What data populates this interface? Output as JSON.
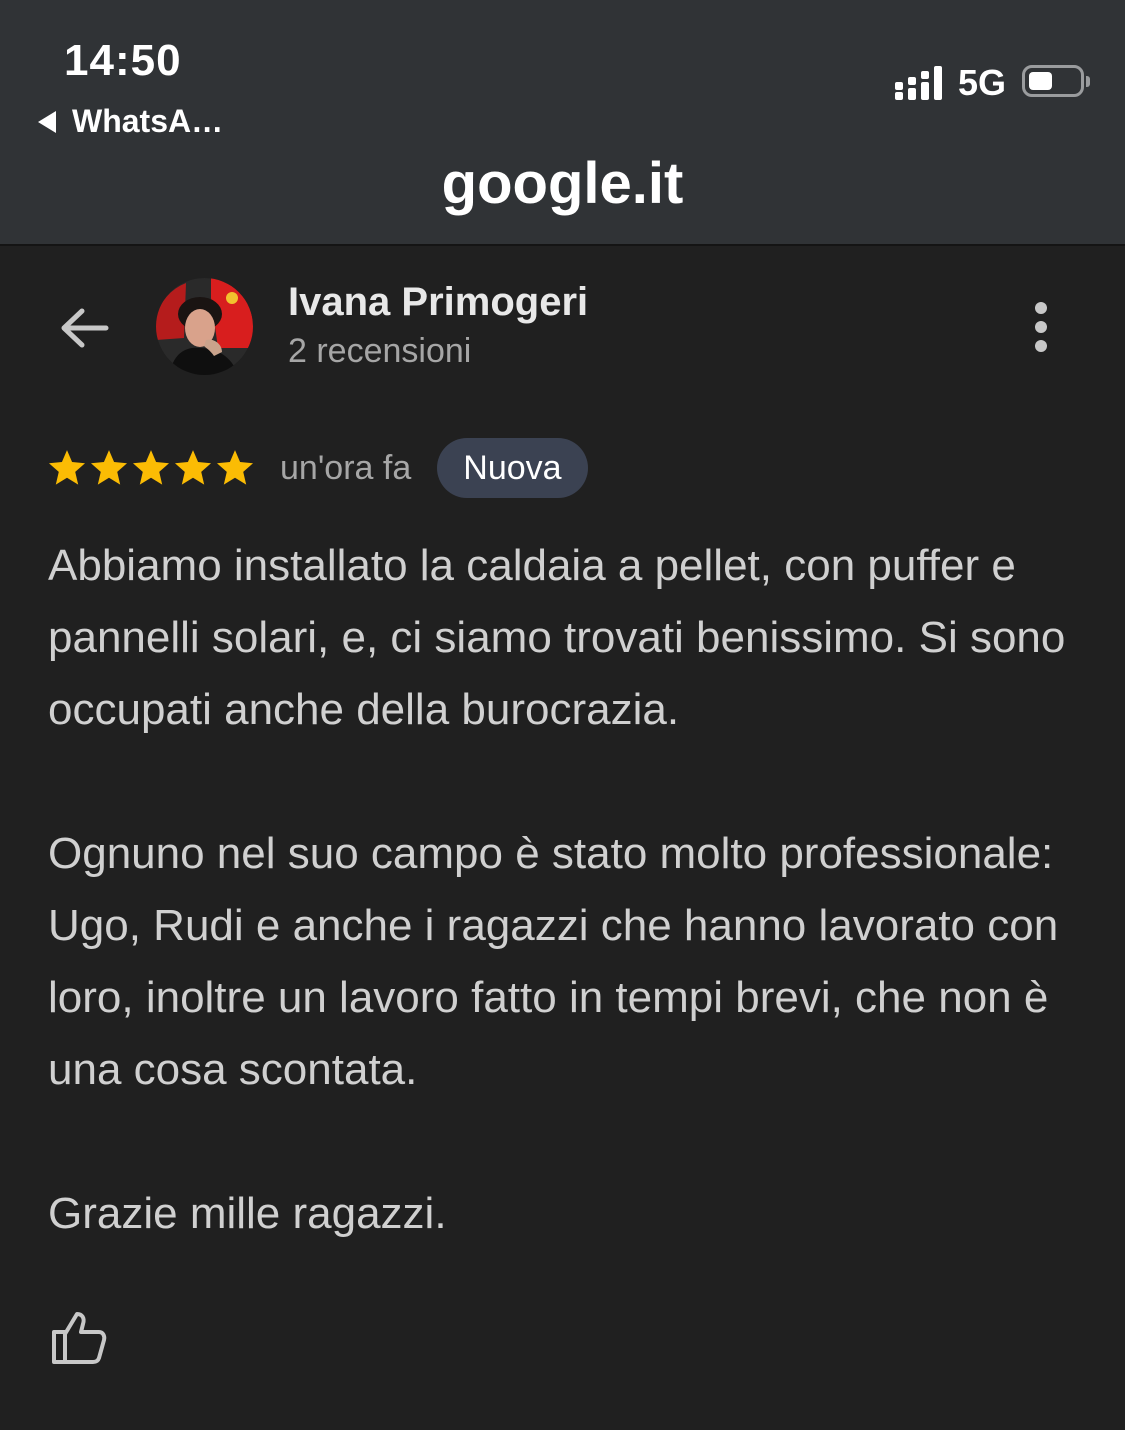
{
  "status_bar": {
    "time": "14:50",
    "back_app_label": "WhatsA…",
    "network": "5G",
    "battery_level": 0.45
  },
  "browser": {
    "url": "google.it"
  },
  "review": {
    "reviewer_name": "Ivana Primogeri",
    "reviewer_reviews": "2 recensioni",
    "rating": 5,
    "rating_max": 5,
    "time_ago": "un'ora fa",
    "badge": "Nuova",
    "paragraphs": [
      "Abbiamo installato la caldaia a pellet, con puffer e pannelli solari, e, ci siamo trovati benissimo. Si sono occupati anche della burocrazia.",
      "Ognuno nel suo campo è stato molto professionale: Ugo, Rudi e anche i ragazzi che hanno lavorato con loro, inoltre un lavoro fatto in tempi brevi, che non è una cosa scontata.",
      "Grazie mille ragazzi."
    ]
  },
  "icons": {
    "back": "arrow-left-icon",
    "more": "more-vertical-icon",
    "star": "star-icon",
    "like": "thumbs-up-icon"
  },
  "colors": {
    "background": "#202020",
    "topbar": "#303336",
    "star": "#fbbc04",
    "badge_bg": "#3b4252",
    "text_primary": "#e8e8e8",
    "text_secondary": "#a6a6a6"
  }
}
